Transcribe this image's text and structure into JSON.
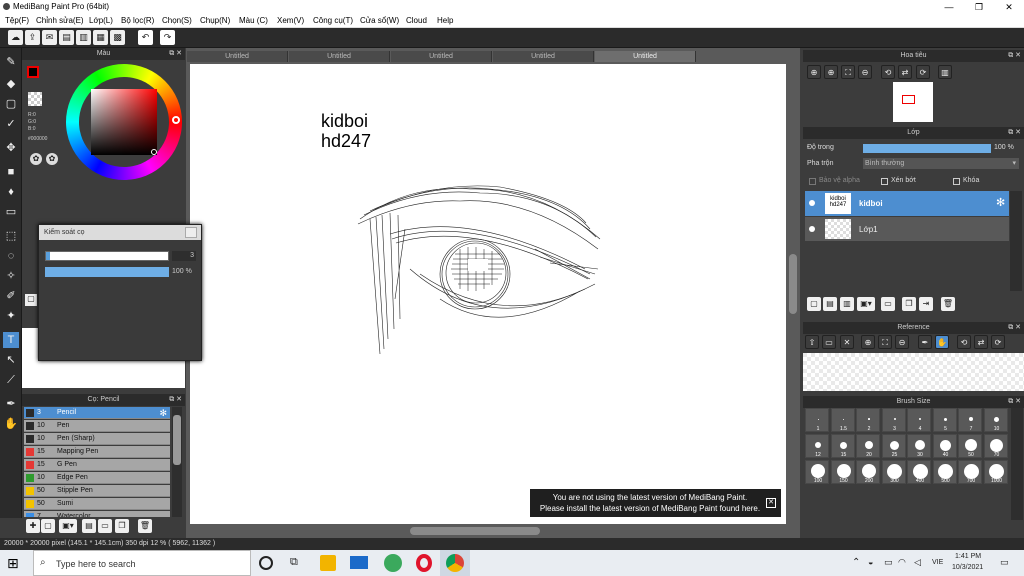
{
  "window": {
    "title": "MediBang Paint Pro (64bit)",
    "minimize_icon": "—",
    "maximize_icon": "❐",
    "close_icon": "✕"
  },
  "menu": [
    "Tệp(F)",
    "Chỉnh sửa(E)",
    "Lớp(L)",
    "Bộ lọc(R)",
    "Chọn(S)",
    "Chụp(N)",
    "Màu (C)",
    "Xem(V)",
    "Công cụ(T)",
    "Cửa sổ(W)",
    "Cloud",
    "Help"
  ],
  "color_panel": {
    "title": "Màu",
    "rgb": [
      "R:0",
      "G:0",
      "B:0"
    ],
    "hex": "#000000",
    "current_color": "#000000"
  },
  "brush_control": {
    "title": "Kiểm soát cọ",
    "size_value": "3",
    "opacity_value": "100 %"
  },
  "brush_panel": {
    "title": "Cọ: Pencil",
    "items": [
      {
        "size": "3",
        "name": "Pencil",
        "color": "#2b2b2b",
        "selected": true
      },
      {
        "size": "10",
        "name": "Pen",
        "color": "#2b2b2b"
      },
      {
        "size": "10",
        "name": "Pen (Sharp)",
        "color": "#2b2b2b"
      },
      {
        "size": "15",
        "name": "Mapping Pen",
        "color": "#e53935"
      },
      {
        "size": "15",
        "name": "G Pen",
        "color": "#e53935"
      },
      {
        "size": "10",
        "name": "Edge Pen",
        "color": "#2e9b2e"
      },
      {
        "size": "50",
        "name": "Stipple Pen",
        "color": "#f2c200"
      },
      {
        "size": "50",
        "name": "Sumi",
        "color": "#f2c200"
      },
      {
        "size": "7",
        "name": "Watercolor",
        "color": "#3a8ee6"
      }
    ]
  },
  "doc_tabs": [
    "Untitled",
    "Untitled",
    "Untitled",
    "Untitled",
    "Untitled"
  ],
  "canvas": {
    "text_line1": "kidboi",
    "text_line2": "hd247"
  },
  "navigator": {
    "title": "Hoa tiêu"
  },
  "layer_panel": {
    "title": "Lớp",
    "opacity_label": "Độ trong",
    "opacity_value": "100 %",
    "opacity_fraction": 1.0,
    "blend_label": "Pha trộn",
    "blend_value": "Bình thường",
    "alpha_label": "Bảo vệ alpha",
    "clip_label": "Xén bớt",
    "lock_label": "Khóa",
    "layers": [
      {
        "name": "kidboi",
        "thumb_text": "kidboi hd247",
        "selected": true
      },
      {
        "name": "Lớp1",
        "selected": false
      }
    ]
  },
  "reference": {
    "title": "Reference"
  },
  "brush_size": {
    "title": "Brush Size",
    "sizes": [
      "1",
      "1.5",
      "2",
      "3",
      "4",
      "5",
      "7",
      "10",
      "12",
      "15",
      "20",
      "25",
      "30",
      "40",
      "50",
      "70",
      "100",
      "150",
      "200",
      "300",
      "400",
      "500",
      "700",
      "1000"
    ]
  },
  "notification": {
    "line1": "You are not using the latest version of MediBang Paint.",
    "line2": "Please install the latest version of MediBang Paint found here."
  },
  "status": {
    "text": "20000 * 20000 pixel  (145.1 * 145.1cm)  350 dpi  12 %  ( 5962, 11362 )"
  },
  "taskbar": {
    "search_placeholder": "Type here to search",
    "time": "1:41 PM",
    "date": "10/3/2021",
    "lang": "VIE"
  },
  "colors": {
    "accent": "#4d8ed0",
    "panel": "#3c3c3c"
  }
}
